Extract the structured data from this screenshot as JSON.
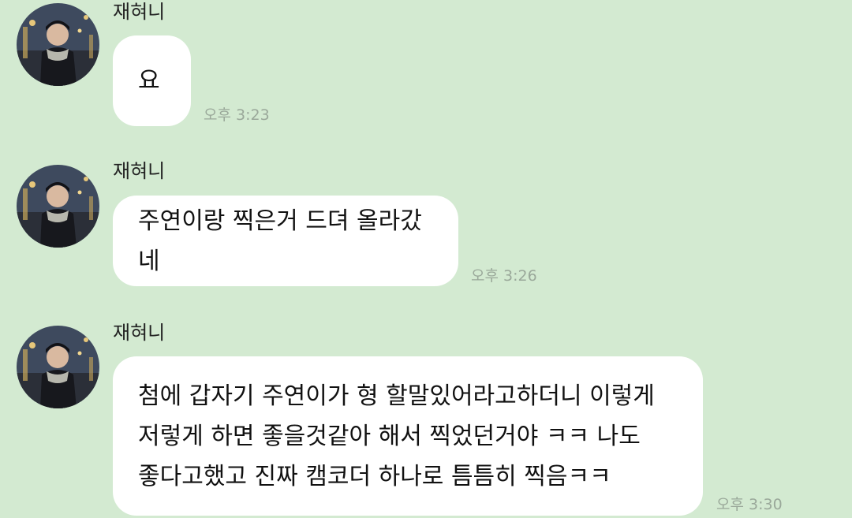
{
  "messages": [
    {
      "sender": "재혀니",
      "text": "요",
      "time": "오후 3:23"
    },
    {
      "sender": "재혀니",
      "text": "주연이랑 찍은거 드뎌 올라갔네",
      "time": "오후 3:26"
    },
    {
      "sender": "재혀니",
      "text": "첨에 갑자기 주연이가 형 할말있어라고하더니 이렇게\n저렇게 하면 좋을것같아 해서 찍었던거야 ㅋㅋ 나도\n좋다고했고 진짜 캠코더 하나로 틈틈히 찍음ㅋㅋ",
      "time": "오후 3:30"
    }
  ],
  "colors": {
    "background": "#d3ead1",
    "bubble": "#ffffff",
    "time_text": "#9aa89a"
  },
  "icons": {
    "avatar": "profile-photo"
  }
}
